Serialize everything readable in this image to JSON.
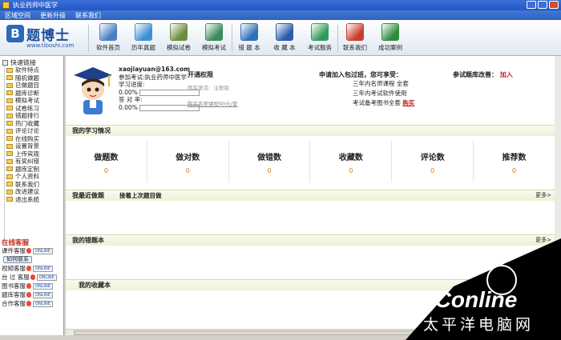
{
  "window": {
    "title": "执业药师中医学"
  },
  "menu": [
    "区域空间",
    "更新升级",
    "联系我们"
  ],
  "logo": {
    "mark": "B",
    "name": "题博士",
    "url": "www.tiboshi.com"
  },
  "toolbar": [
    {
      "label": "软件首页",
      "color": "#4a7fc1"
    },
    {
      "label": "历年真题",
      "color": "#3d8fd8"
    },
    {
      "label": "模拟试卷",
      "color": "#6b8c3a"
    },
    {
      "label": "模拟考试",
      "color": "#3a8c5c"
    },
    {
      "label": "错 题 本",
      "color": "#2f6fb8"
    },
    {
      "label": "收 藏 本",
      "color": "#2a5ba8"
    },
    {
      "label": "考试服务",
      "color": "#2f9c58"
    },
    {
      "label": "联系我们",
      "color": "#c83e2e"
    },
    {
      "label": "成功案例",
      "color": "#2f8c3c"
    }
  ],
  "sidebar": {
    "header": "快速链接",
    "items": [
      "软件特点",
      "随机做题",
      "已做题目",
      "题库诊断",
      "模拟考试",
      "试卷练习",
      "错题排行",
      "热门收藏",
      "评论讨论",
      "在线购买",
      "设置背景",
      "上传宾观",
      "有奖纠错",
      "题库定制",
      "个人资料",
      "联系我们",
      "改进建议",
      "退出系统"
    ],
    "online_title": "在线客服",
    "online": [
      {
        "label": "课件客服",
        "badge": "ONLINE"
      },
      {
        "label": "如何联系",
        "badge": ""
      },
      {
        "label": "视频客服",
        "badge": "ONLINE"
      },
      {
        "label": "台 过 客服",
        "badge": "ONLINE"
      },
      {
        "label": "图书客服",
        "badge": "ONLINE"
      },
      {
        "label": "题库客服",
        "badge": "ONLINE"
      },
      {
        "label": "合作客服",
        "badge": "ONLINE"
      }
    ]
  },
  "profile": {
    "email": "xaojiayuan@163.com",
    "exam": "参加考试:执业药师中医学",
    "progress_label": "学习进度:",
    "progress_value": "0.00%",
    "accuracy_label": "答 对 率:",
    "accuracy_value": "0.00%"
  },
  "permissions": {
    "title": "开通权限",
    "line1": "题库激活：注册版",
    "line2": "购买名师课程90元/套"
  },
  "apply": {
    "title": "申请加入包过班，您可享受：",
    "lines": [
      "三年内名师课程 全套",
      "三年内考试软件使用",
      "考试备考图书全套"
    ],
    "buy": "购买"
  },
  "refer": {
    "text": "参试题库改善：",
    "join": "加入"
  },
  "sections": {
    "study": "我的学习情况",
    "recent": "我最近做题",
    "recent_sub": "接着上次题目做",
    "wrong": "我的错题本",
    "fav": "我的收藏本",
    "more": "更多>"
  },
  "stats": [
    {
      "label": "做题数",
      "value": "0"
    },
    {
      "label": "做对数",
      "value": "0"
    },
    {
      "label": "做错数",
      "value": "0"
    },
    {
      "label": "收藏数",
      "value": "0"
    },
    {
      "label": "评论数",
      "value": "0"
    },
    {
      "label": "推荐数",
      "value": "0"
    }
  ],
  "watermark": {
    "brand": "PConline",
    "sub": "太平洋电脑网"
  }
}
